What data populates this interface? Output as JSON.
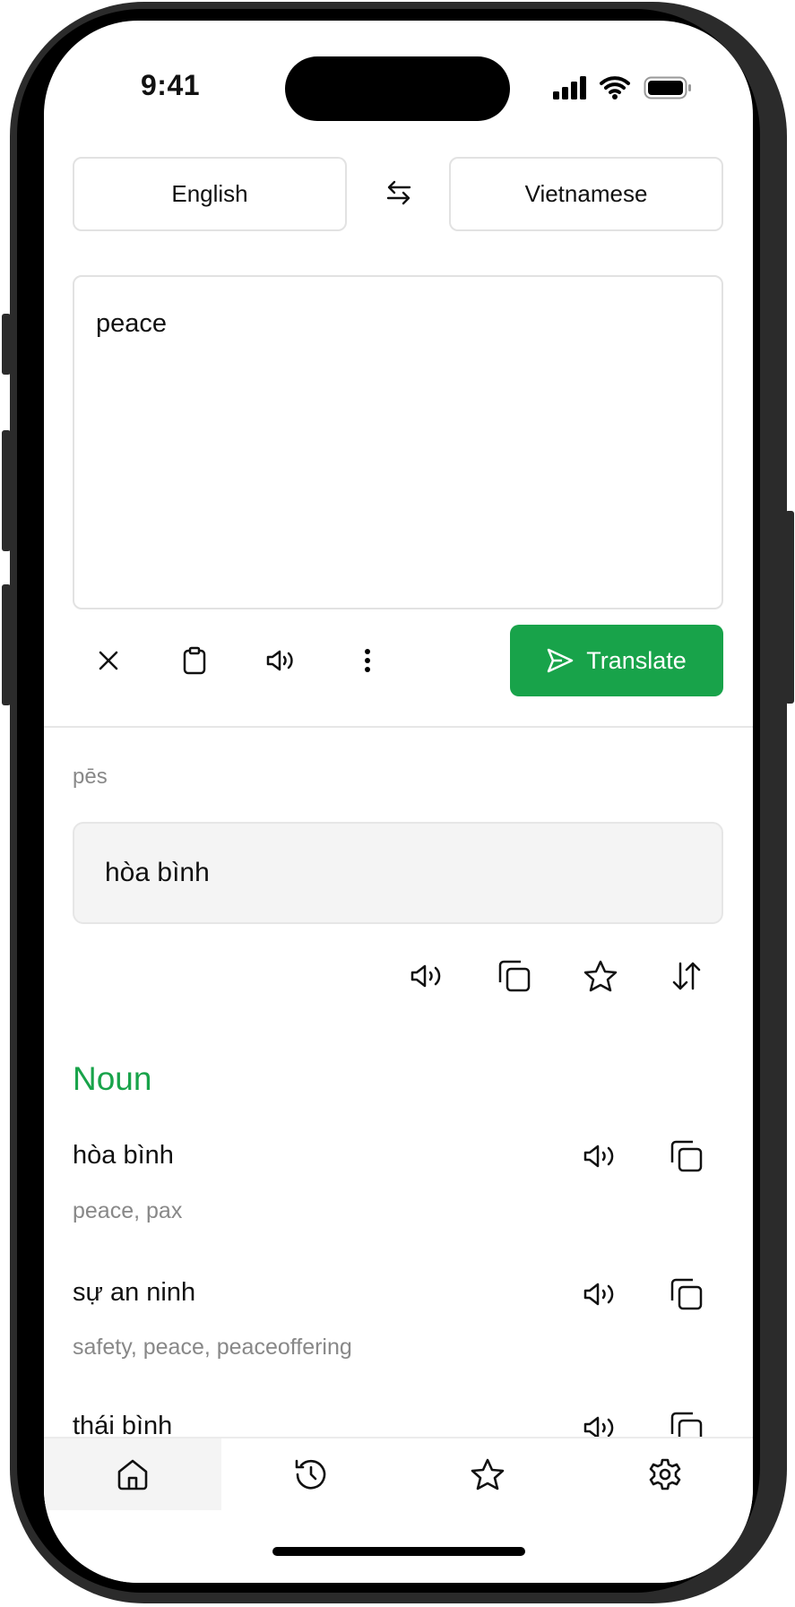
{
  "status_bar": {
    "time": "9:41",
    "icons": [
      "cellular-signal-icon",
      "wifi-icon",
      "battery-icon"
    ]
  },
  "languages": {
    "source": "English",
    "target": "Vietnamese",
    "swap_icon": "swap-arrows-icon"
  },
  "input": {
    "value": "peace"
  },
  "toolbar": {
    "icons": [
      "close-icon",
      "clipboard-icon",
      "speaker-icon",
      "more-vertical-icon"
    ],
    "translate_label": "Translate"
  },
  "result": {
    "phonetic": "pēs",
    "translation": "hòa bình",
    "actions": [
      "speaker-icon",
      "copy-icon",
      "star-icon",
      "sort-arrows-icon"
    ]
  },
  "dictionary": {
    "part_of_speech": "Noun",
    "entries": [
      {
        "word": "hòa bình",
        "meanings": "peace, pax"
      },
      {
        "word": "sự an ninh",
        "meanings": "safety, peace, peaceoffering"
      },
      {
        "word": "thái bình",
        "meanings": ""
      }
    ]
  },
  "nav": {
    "tabs": [
      "home",
      "history",
      "favorites",
      "settings"
    ],
    "active": "home"
  },
  "colors": {
    "accent": "#18a34a",
    "muted_text": "#888888",
    "result_bg": "#f4f4f4"
  }
}
